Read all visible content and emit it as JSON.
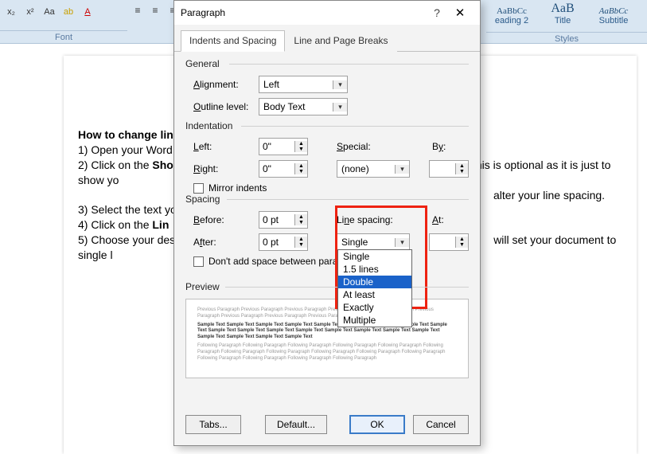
{
  "ribbon": {
    "font_label": "Font",
    "styles_label": "Styles",
    "styles": [
      {
        "preview": "AaBbCc",
        "label": "eading 2"
      },
      {
        "preview": "AaB",
        "label": "Title"
      },
      {
        "preview": "AaBbCc",
        "label": "Subtitle"
      }
    ]
  },
  "doc": {
    "heading": "How to change lin",
    "l1": "1) Open your Word",
    "l2a": "2) Click on the ",
    "l2b": "Sho",
    "l2c": "his is optional as it is just to show yo",
    "l2d": "alter your line spacing.",
    "l3": "3) Select the text yo",
    "l4a": "4) Click on the ",
    "l4b": "Lin",
    "l5a": "5) Choose your des",
    "l5b": "will set your document to single l"
  },
  "dialog": {
    "title": "Paragraph",
    "tabs": {
      "indent": "Indents and Spacing",
      "breaks": "Line and Page Breaks"
    },
    "general": {
      "label": "General",
      "alignment_label": "Alignment:",
      "alignment_value": "Left",
      "outline_label": "Outline level:",
      "outline_value": "Body Text"
    },
    "indent": {
      "label": "Indentation",
      "left_label": "Left:",
      "left_value": "0\"",
      "right_label": "Right:",
      "right_value": "0\"",
      "special_label": "Special:",
      "special_value": "(none)",
      "by_label": "By:",
      "by_value": "",
      "mirror": "Mirror indents"
    },
    "spacing": {
      "label": "Spacing",
      "before_label": "Before:",
      "before_value": "0 pt",
      "after_label": "After:",
      "after_value": "0 pt",
      "ls_label": "Line spacing:",
      "ls_value": "Single",
      "at_label": "At:",
      "at_value": "",
      "noadd": "Don't add space between paragra",
      "options": [
        "Single",
        "1.5 lines",
        "Double",
        "At least",
        "Exactly",
        "Multiple"
      ]
    },
    "preview": {
      "label": "Preview",
      "grey1": "Previous Paragraph Previous Paragraph Previous Paragraph Previous Paragraph Previous Paragraph Previous Paragraph Previous Paragraph Previous Paragraph Previous Paragraph Previous Paragraph",
      "dark": "Sample Text Sample Text Sample Text Sample Text Sample Text Sample Text Sample Text Sample Text Sample Text Sample Text Sample Text Sample Text Sample Text Sample Text Sample Text Sample Text Sample Text Sample Text Sample Text Sample Text Sample Text",
      "grey2": "Following Paragraph Following Paragraph Following Paragraph Following Paragraph Following Paragraph Following Paragraph Following Paragraph Following Paragraph Following Paragraph Following Paragraph Following Paragraph Following Paragraph Following Paragraph Following Paragraph Following Paragraph"
    },
    "buttons": {
      "tabs": "Tabs...",
      "default": "Default...",
      "ok": "OK",
      "cancel": "Cancel"
    }
  }
}
